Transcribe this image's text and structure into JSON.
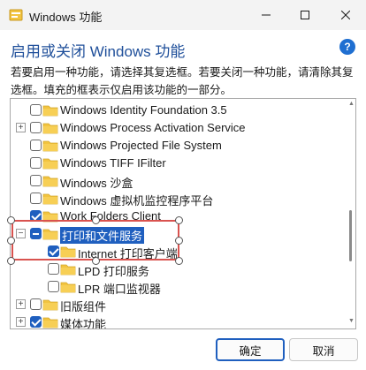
{
  "window": {
    "title": "Windows 功能",
    "minimize_icon": "minimize-icon",
    "maximize_icon": "maximize-icon",
    "close_icon": "close-icon"
  },
  "header": {
    "heading": "启用或关闭 Windows 功能",
    "help_icon": "help-icon",
    "help_glyph": "?"
  },
  "description": "若要启用一种功能，请选择其复选框。若要关闭一种功能，请清除其复选框。填充的框表示仅启用该功能的一部分。",
  "features": [
    {
      "label": "Windows Identity Foundation 3.5",
      "state": "unchecked",
      "expander": ""
    },
    {
      "label": "Windows Process Activation Service",
      "state": "unchecked",
      "expander": "+"
    },
    {
      "label": "Windows Projected File System",
      "state": "unchecked",
      "expander": ""
    },
    {
      "label": "Windows TIFF IFilter",
      "state": "unchecked",
      "expander": ""
    },
    {
      "label": "Windows 沙盒",
      "state": "unchecked",
      "expander": ""
    },
    {
      "label": "Windows 虚拟机监控程序平台",
      "state": "unchecked",
      "expander": ""
    },
    {
      "label": "Work Folders Client",
      "state": "checked",
      "expander": ""
    },
    {
      "label": "打印和文件服务",
      "state": "partial",
      "expander": "−",
      "selected": true
    },
    {
      "label": "Internet 打印客户端",
      "state": "checked",
      "expander": "",
      "child": true
    },
    {
      "label": "LPD 打印服务",
      "state": "unchecked",
      "expander": "",
      "child": true
    },
    {
      "label": "LPR 端口监视器",
      "state": "unchecked",
      "expander": "",
      "child": true
    },
    {
      "label": "旧版组件",
      "state": "unchecked",
      "expander": "+"
    },
    {
      "label": "媒体功能",
      "state": "checked",
      "expander": "+"
    }
  ],
  "buttons": {
    "ok": "确定",
    "cancel": "取消"
  },
  "colors": {
    "accent": "#1f5fbf",
    "folder": "#f2c440",
    "annotation": "#d9534f",
    "heading": "#1f4f9a"
  }
}
